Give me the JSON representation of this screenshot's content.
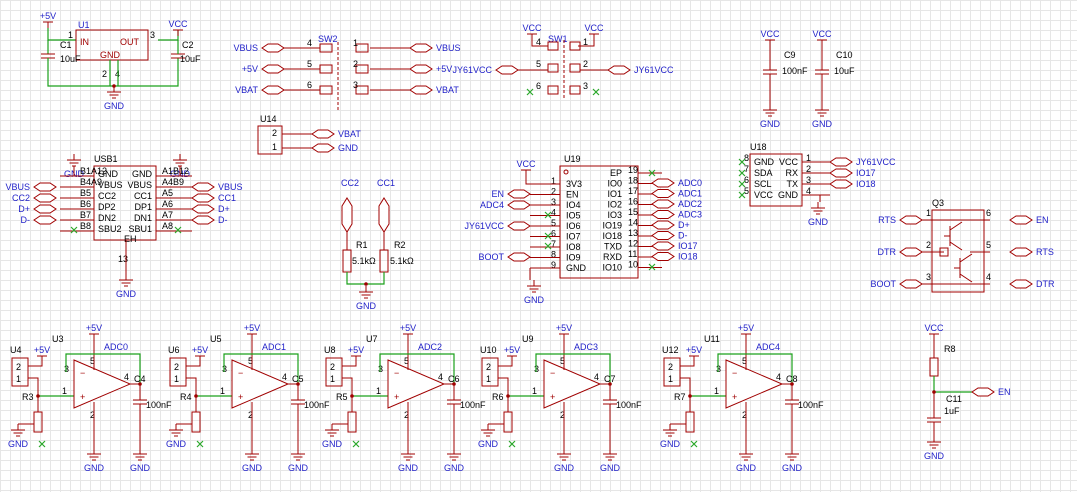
{
  "nets": {
    "p5v": "+5V",
    "vcc": "VCC",
    "gnd": "GND",
    "vbus": "VBUS",
    "vbat": "VBAT",
    "jy": "JY61VCC",
    "en": "EN",
    "boot": "BOOT",
    "rts": "RTS",
    "dtr": "DTR",
    "dp": "D+",
    "dm": "D-",
    "cc1": "CC1",
    "cc2": "CC2",
    "adc0": "ADC0",
    "adc1": "ADC1",
    "adc2": "ADC2",
    "adc3": "ADC3",
    "adc4": "ADC4",
    "io17": "IO17",
    "io18": "IO18"
  },
  "u1": {
    "ref": "U1",
    "in": "IN",
    "out": "OUT",
    "gnd": "GND",
    "p1": "1",
    "p3": "3",
    "p2": "2",
    "p4": "4"
  },
  "caps": {
    "c1": "C1",
    "c2": "C2",
    "c9": "C9",
    "c10": "C10",
    "c11": "C11",
    "c4": "C4",
    "c5": "C5",
    "c6": "C6",
    "c7": "C7",
    "c8": "C8",
    "v10u": "10uF",
    "v100n": "100nF",
    "v1u": "1uF"
  },
  "sw2": {
    "ref": "SW2",
    "pins": [
      "4",
      "5",
      "6",
      "1",
      "2",
      "3"
    ]
  },
  "sw1": {
    "ref": "SW1",
    "pins": [
      "4",
      "5",
      "6",
      "1",
      "2",
      "3"
    ]
  },
  "u14": {
    "ref": "U14",
    "p2": "2",
    "p1": "1"
  },
  "usb1": {
    "ref": "USB1",
    "left": [
      "GND",
      "VBUS",
      "CC2",
      "DP2",
      "DN2",
      "SBU2"
    ],
    "right": [
      "GND",
      "VBUS",
      "CC1",
      "DP1",
      "DN1",
      "SBU1"
    ],
    "lp": [
      "B1A12",
      "B4A9",
      "B5",
      "B6",
      "B7",
      "B8"
    ],
    "rp": [
      "A1B12",
      "A4B9",
      "A5",
      "A6",
      "A7",
      "A8"
    ],
    "eh": "EH",
    "p13": "13"
  },
  "r": {
    "r1": "R1",
    "r2": "R2",
    "v": "5.1kΩ",
    "r3": "R3",
    "r4": "R4",
    "r5": "R5",
    "r6": "R6",
    "r7": "R7",
    "r8": "R8"
  },
  "u19": {
    "ref": "U19",
    "left": [
      "3V3",
      "EN",
      "IO4",
      "IO5",
      "IO6",
      "IO7",
      "IO8",
      "IO9",
      "GND"
    ],
    "lp": [
      "1",
      "2",
      "3",
      "4",
      "5",
      "6",
      "7",
      "8",
      "9"
    ],
    "right": [
      "EP",
      "IO0",
      "IO1",
      "IO2",
      "IO3",
      "IO19",
      "IO18",
      "TXD",
      "RXD",
      "IO10"
    ],
    "rp": [
      "19",
      "18",
      "17",
      "16",
      "15",
      "14",
      "13",
      "12",
      "11",
      "10"
    ]
  },
  "u18": {
    "ref": "U18",
    "left": [
      "GND",
      "SDA",
      "SCL",
      "VCC"
    ],
    "right": [
      "VCC",
      "RX",
      "TX",
      "GND"
    ],
    "lp": [
      "8",
      "7",
      "6",
      "5"
    ],
    "rp": [
      "1",
      "2",
      "3",
      "4"
    ]
  },
  "q3": {
    "ref": "Q3",
    "p1": "1",
    "p2": "2",
    "p3": "3",
    "p4": "4",
    "p5": "5",
    "p6": "6"
  },
  "amps": [
    {
      "u": "U3",
      "j": "U4",
      "r": "R3",
      "c": "C4",
      "adc": "ADC0"
    },
    {
      "u": "U5",
      "j": "U6",
      "r": "R4",
      "c": "C5",
      "adc": "ADC1"
    },
    {
      "u": "U7",
      "j": "U8",
      "r": "R5",
      "c": "C6",
      "adc": "ADC2"
    },
    {
      "u": "U9",
      "j": "U10",
      "r": "R6",
      "c": "C7",
      "adc": "ADC3"
    },
    {
      "u": "U11",
      "j": "U12",
      "r": "R7",
      "c": "C8",
      "adc": "ADC4"
    }
  ]
}
